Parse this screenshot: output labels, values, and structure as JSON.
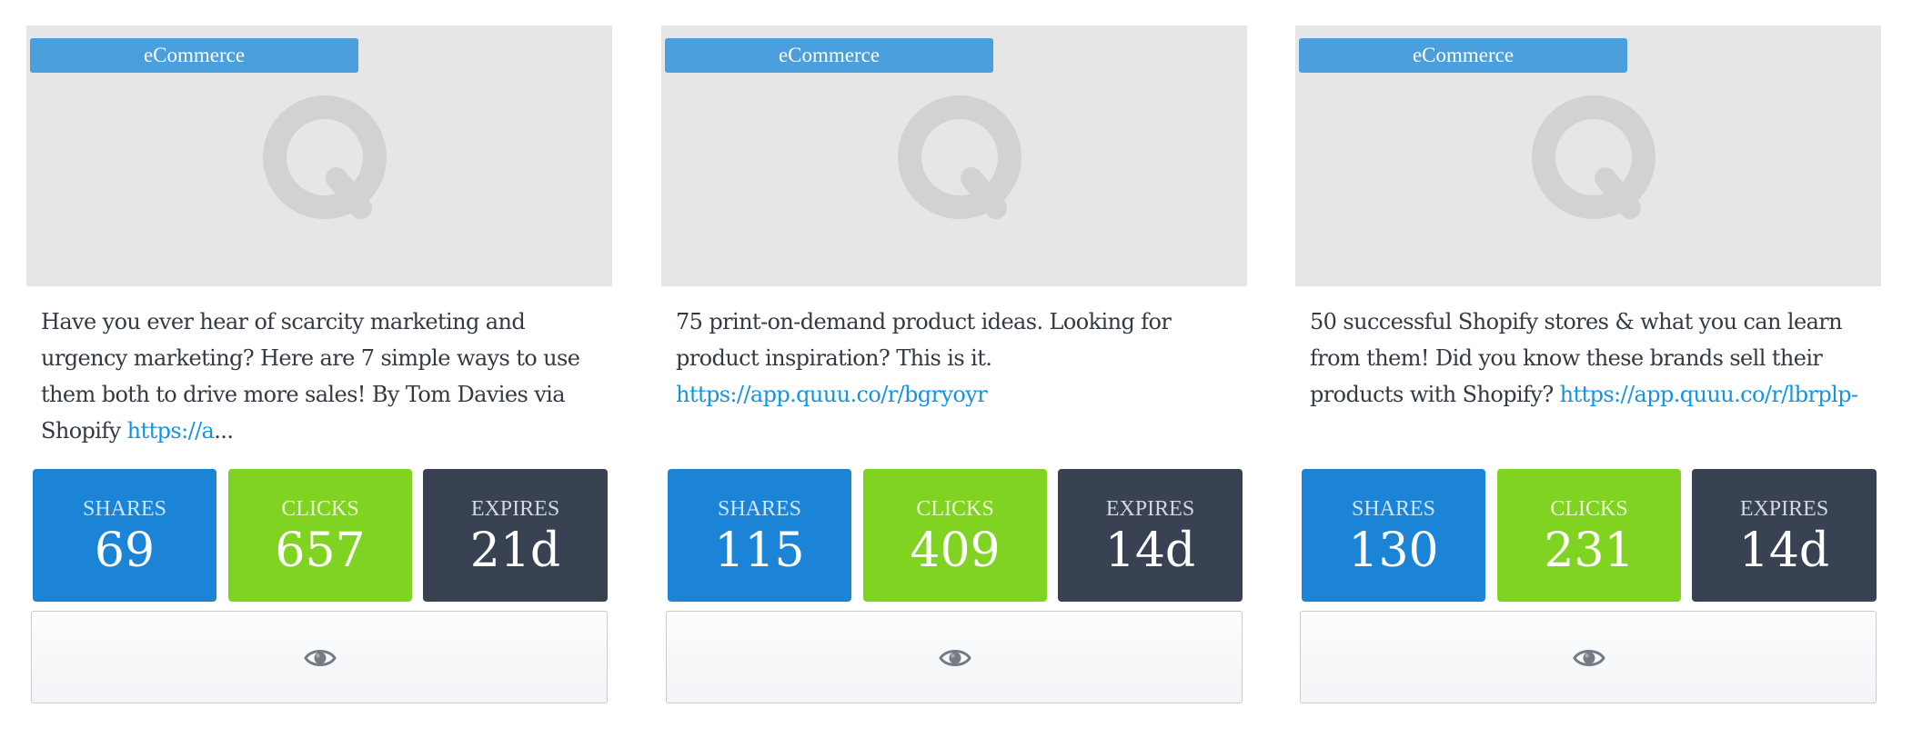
{
  "colors": {
    "shares": "#1b84d6",
    "clicks": "#80d321",
    "expires": "#384252",
    "badge": "#4a9fdc",
    "link": "#1593e0"
  },
  "cards": [
    {
      "category": "eCommerce",
      "thumbnail_icon": "quuu-q-logo-icon",
      "text": "Have you ever hear of scarcity marketing and urgency marketing? Here are 7 simple ways to use them both to drive more sales! By Tom Davies via Shopify ",
      "link": "https://a",
      "link_suffix": "...",
      "stats": {
        "shares_label": "SHARES",
        "shares": "69",
        "clicks_label": "CLICKS",
        "clicks": "657",
        "expires_label": "EXPIRES",
        "expires": "21d"
      },
      "preview_icon": "eye-icon"
    },
    {
      "category": "eCommerce",
      "thumbnail_icon": "quuu-q-logo-icon",
      "text": "75 print-on-demand product ideas. Looking for product inspiration? This is it. ",
      "link": "https://app.quuu.co/r/bgryoyr",
      "link_suffix": "",
      "stats": {
        "shares_label": "SHARES",
        "shares": "115",
        "clicks_label": "CLICKS",
        "clicks": "409",
        "expires_label": "EXPIRES",
        "expires": "14d"
      },
      "preview_icon": "eye-icon"
    },
    {
      "category": "eCommerce",
      "thumbnail_icon": "quuu-q-logo-icon",
      "text": "50 successful Shopify stores & what you can learn from them! Did you know these brands sell their products with Shopify? ",
      "link": "https://app.quuu.co/r/lbrplp-",
      "link_suffix": "",
      "stats": {
        "shares_label": "SHARES",
        "shares": "130",
        "clicks_label": "CLICKS",
        "clicks": "231",
        "expires_label": "EXPIRES",
        "expires": "14d"
      },
      "preview_icon": "eye-icon"
    }
  ]
}
